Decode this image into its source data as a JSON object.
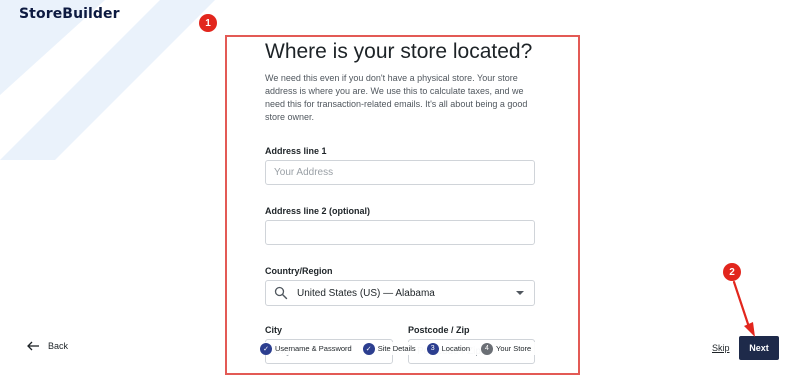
{
  "brand": {
    "logo_text": "StoreBuilder"
  },
  "annotations": {
    "marker_1": "1",
    "marker_2": "2"
  },
  "form": {
    "title": "Where is your store located?",
    "description": "We need this even if you don't have a physical store. Your store address is where you are. We use this to calculate taxes, and we need this for transaction-related emails. It's all about being a good store owner.",
    "address_line_1": {
      "label": "Address line 1",
      "placeholder": "Your Address",
      "value": ""
    },
    "address_line_2": {
      "label": "Address line 2 (optional)",
      "placeholder": "",
      "value": ""
    },
    "country": {
      "label": "Country/Region",
      "selected": "United States (US) — Alabama"
    },
    "city": {
      "label": "City",
      "placeholder": "City",
      "value": ""
    },
    "postcode": {
      "label": "Postcode / Zip",
      "placeholder": "Postcode / Zip",
      "value": ""
    }
  },
  "stepper": {
    "steps": [
      {
        "label": "Username & Password",
        "state": "done",
        "marker": "✓"
      },
      {
        "label": "Site Details",
        "state": "done",
        "marker": "✓"
      },
      {
        "label": "Location",
        "state": "current",
        "marker": "3"
      },
      {
        "label": "Your Store",
        "state": "future",
        "marker": "4"
      }
    ]
  },
  "footer": {
    "back_label": "Back",
    "skip_label": "Skip",
    "next_label": "Next"
  },
  "colors": {
    "brand": "#0d1a40",
    "next_button": "#1e2a4a",
    "highlight": "#e35a55",
    "marker": "#e2261d",
    "step_active": "#2c3e8f",
    "swoosh": "#e8f1fb"
  }
}
